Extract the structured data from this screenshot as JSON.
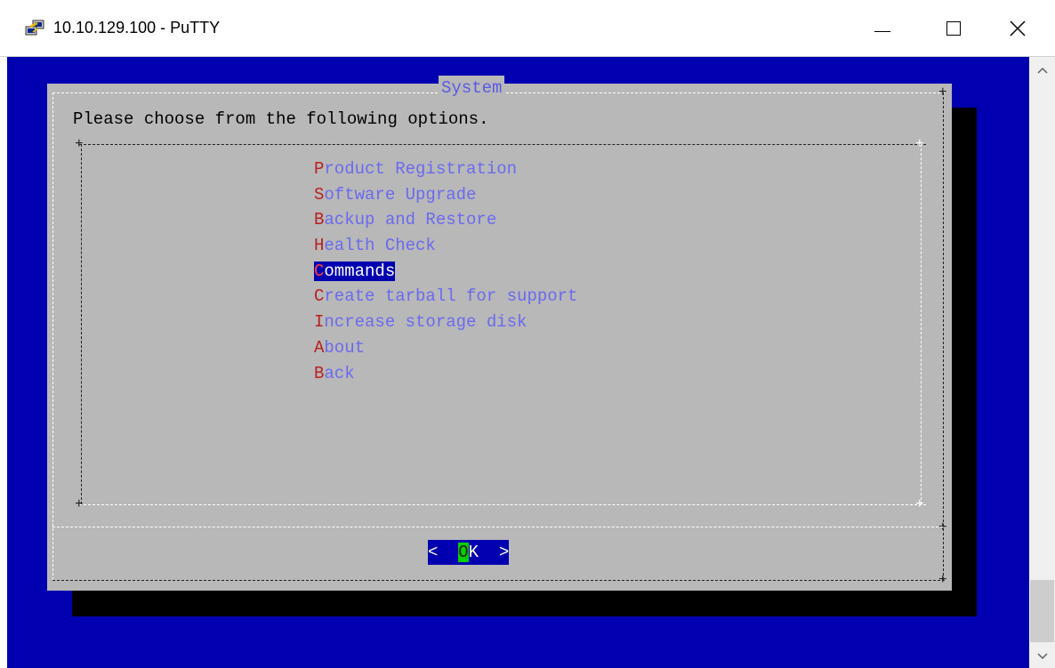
{
  "window": {
    "title": "10.10.129.100 - PuTTY",
    "app_icon": "putty-terminal-icon",
    "controls": {
      "minimize_icon": "minimize-icon",
      "maximize_icon": "maximize-icon",
      "close_glyph": "✕"
    }
  },
  "colors": {
    "terminal_bg": "#0000b0",
    "dialog_bg": "#b8b8b8",
    "menu_text": "#6a6af0",
    "hotkey": "#b82020",
    "ok_hotkey_bg": "#00d000"
  },
  "dialog": {
    "title": "System",
    "prompt": "Please choose from the following options.",
    "menu": [
      {
        "hotkey": "P",
        "rest": "roduct Registration"
      },
      {
        "hotkey": "S",
        "rest": "oftware Upgrade"
      },
      {
        "hotkey": "B",
        "rest": "ackup and Restore"
      },
      {
        "hotkey": "H",
        "rest": "ealth Check"
      },
      {
        "hotkey": "C",
        "rest": "ommands"
      },
      {
        "hotkey": "C",
        "rest": "reate tarball for support"
      },
      {
        "hotkey": "I",
        "rest": "ncrease storage disk"
      },
      {
        "hotkey": "A",
        "rest": "bout"
      },
      {
        "hotkey": "B",
        "rest": "ack"
      }
    ],
    "selected_item": "Commands",
    "ok_button": {
      "left": "<  ",
      "hotkey": "O",
      "rest": "K  >"
    }
  },
  "scrollbar": {
    "up_glyph": "^",
    "down_glyph": "v"
  }
}
